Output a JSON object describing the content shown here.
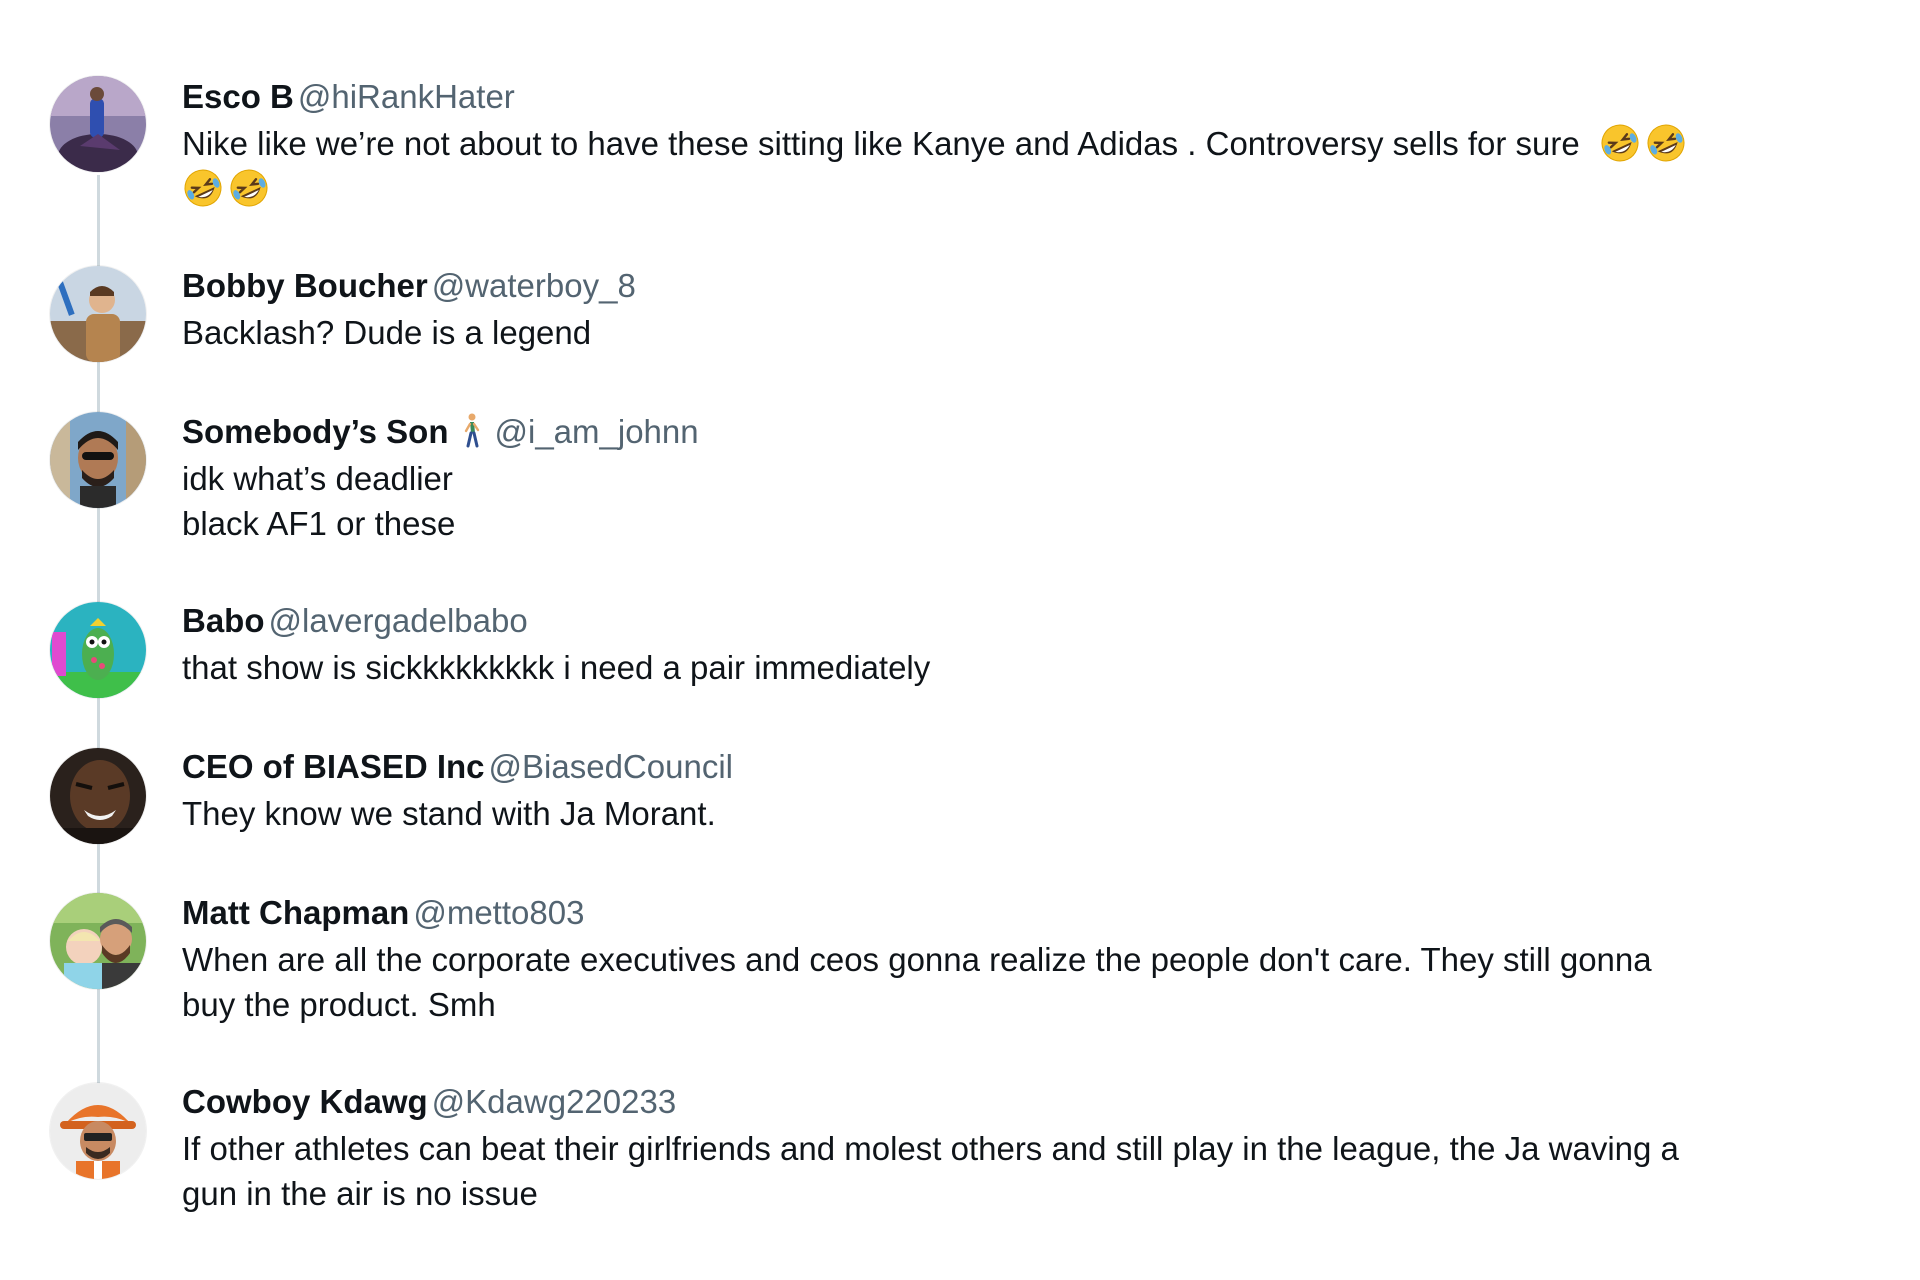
{
  "replies": [
    {
      "display_name": "Esco B",
      "handle": "@hiRankHater",
      "text": "Nike like we’re not about to have these sitting like Kanye and Adidas . Controversy sells for sure",
      "trailing_emoji": [
        "rolling-on-floor-laughing",
        "rolling-on-floor-laughing",
        "rolling-on-floor-laughing",
        "rolling-on-floor-laughing"
      ]
    },
    {
      "display_name": "Bobby Boucher",
      "handle": "@waterboy_8",
      "text": "Backlash? Dude is a legend"
    },
    {
      "display_name": "Somebody’s Son",
      "name_emoji": "person-walking",
      "handle": "@i_am_johnn",
      "text_lines": [
        "idk what’s deadlier",
        "black AF1 or these"
      ]
    },
    {
      "display_name": "Babo",
      "handle": "@lavergadelbabo",
      "text": "that show is sickkkkkkkkk i need a pair immediately"
    },
    {
      "display_name": "CEO of BIASED Inc",
      "handle": "@BiasedCouncil",
      "text": "They know we stand with Ja Morant."
    },
    {
      "display_name": "Matt Chapman",
      "handle": "@metto803",
      "text_lines": [
        "When are all the corporate executives and ceos gonna realize the people don't care. They still gonna",
        "buy the product.  Smh"
      ]
    },
    {
      "display_name": "Cowboy Kdawg",
      "handle": "@Kdawg220233",
      "text_lines": [
        "If other athletes can beat their girlfriends and molest others and still play in the league, the Ja waving a",
        "gun in the air is no issue"
      ]
    }
  ],
  "colors": {
    "text": "#0f1419",
    "handle": "#536471",
    "thread_line": "#cfd9de",
    "background": "#ffffff"
  }
}
